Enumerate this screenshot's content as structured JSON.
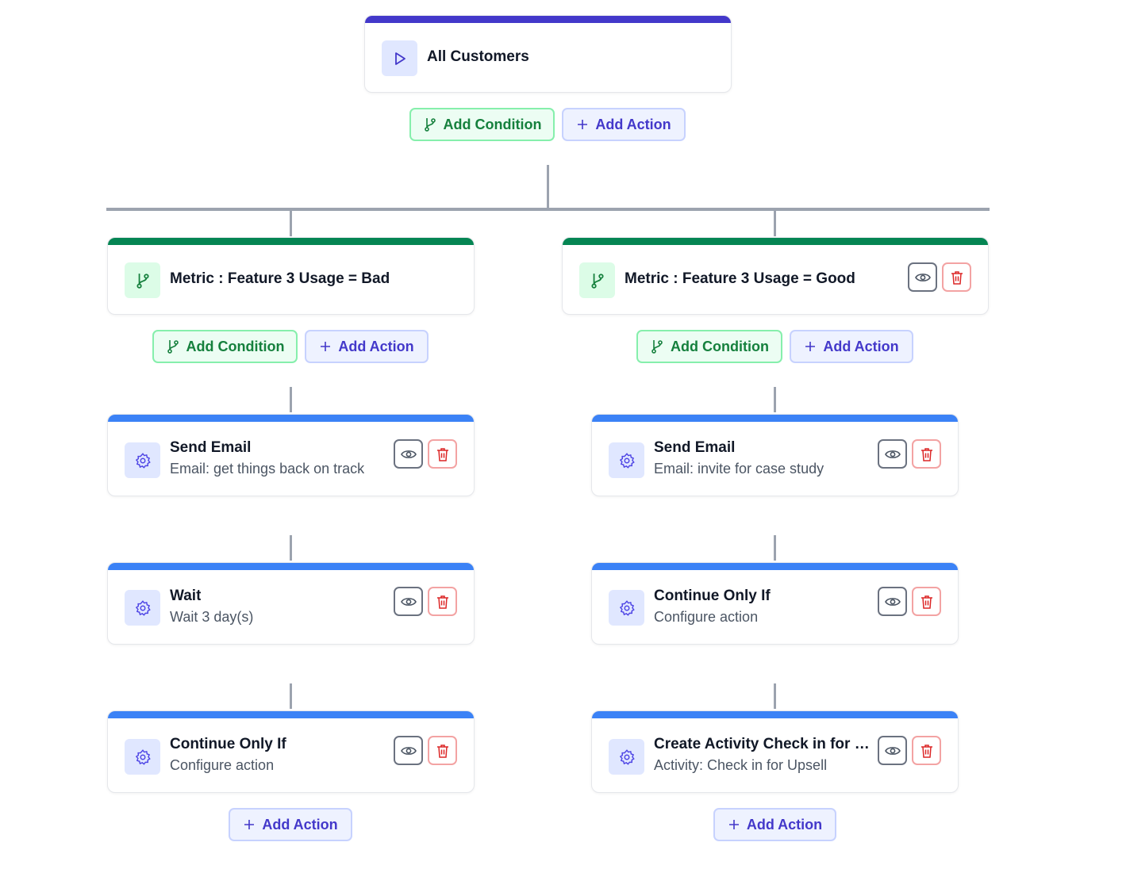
{
  "root": {
    "title": "All Customers"
  },
  "buttons": {
    "add_condition": "Add Condition",
    "add_action": "Add Action"
  },
  "branches": [
    {
      "title": "Metric : Feature 3 Usage = Bad"
    },
    {
      "title": "Metric : Feature 3 Usage = Good"
    }
  ],
  "left_actions": [
    {
      "title": "Send Email",
      "subtitle": "Email: get things back on track"
    },
    {
      "title": "Wait",
      "subtitle": "Wait 3 day(s)"
    },
    {
      "title": "Continue Only If",
      "subtitle": "Configure action"
    }
  ],
  "right_actions": [
    {
      "title": "Send Email",
      "subtitle": "Email: invite for case study"
    },
    {
      "title": "Continue Only If",
      "subtitle": "Configure action"
    },
    {
      "title": "Create Activity Check in for Upsell",
      "subtitle": "Activity: Check in for Upsell"
    }
  ],
  "colors": {
    "trigger_accent": "#4338ca",
    "condition_accent": "#058553",
    "action_accent": "#3b82f6",
    "delete": "#dc2626"
  },
  "icons": [
    "play-icon",
    "branch-icon",
    "plus-icon",
    "gear-icon",
    "eye-icon",
    "trash-icon"
  ]
}
